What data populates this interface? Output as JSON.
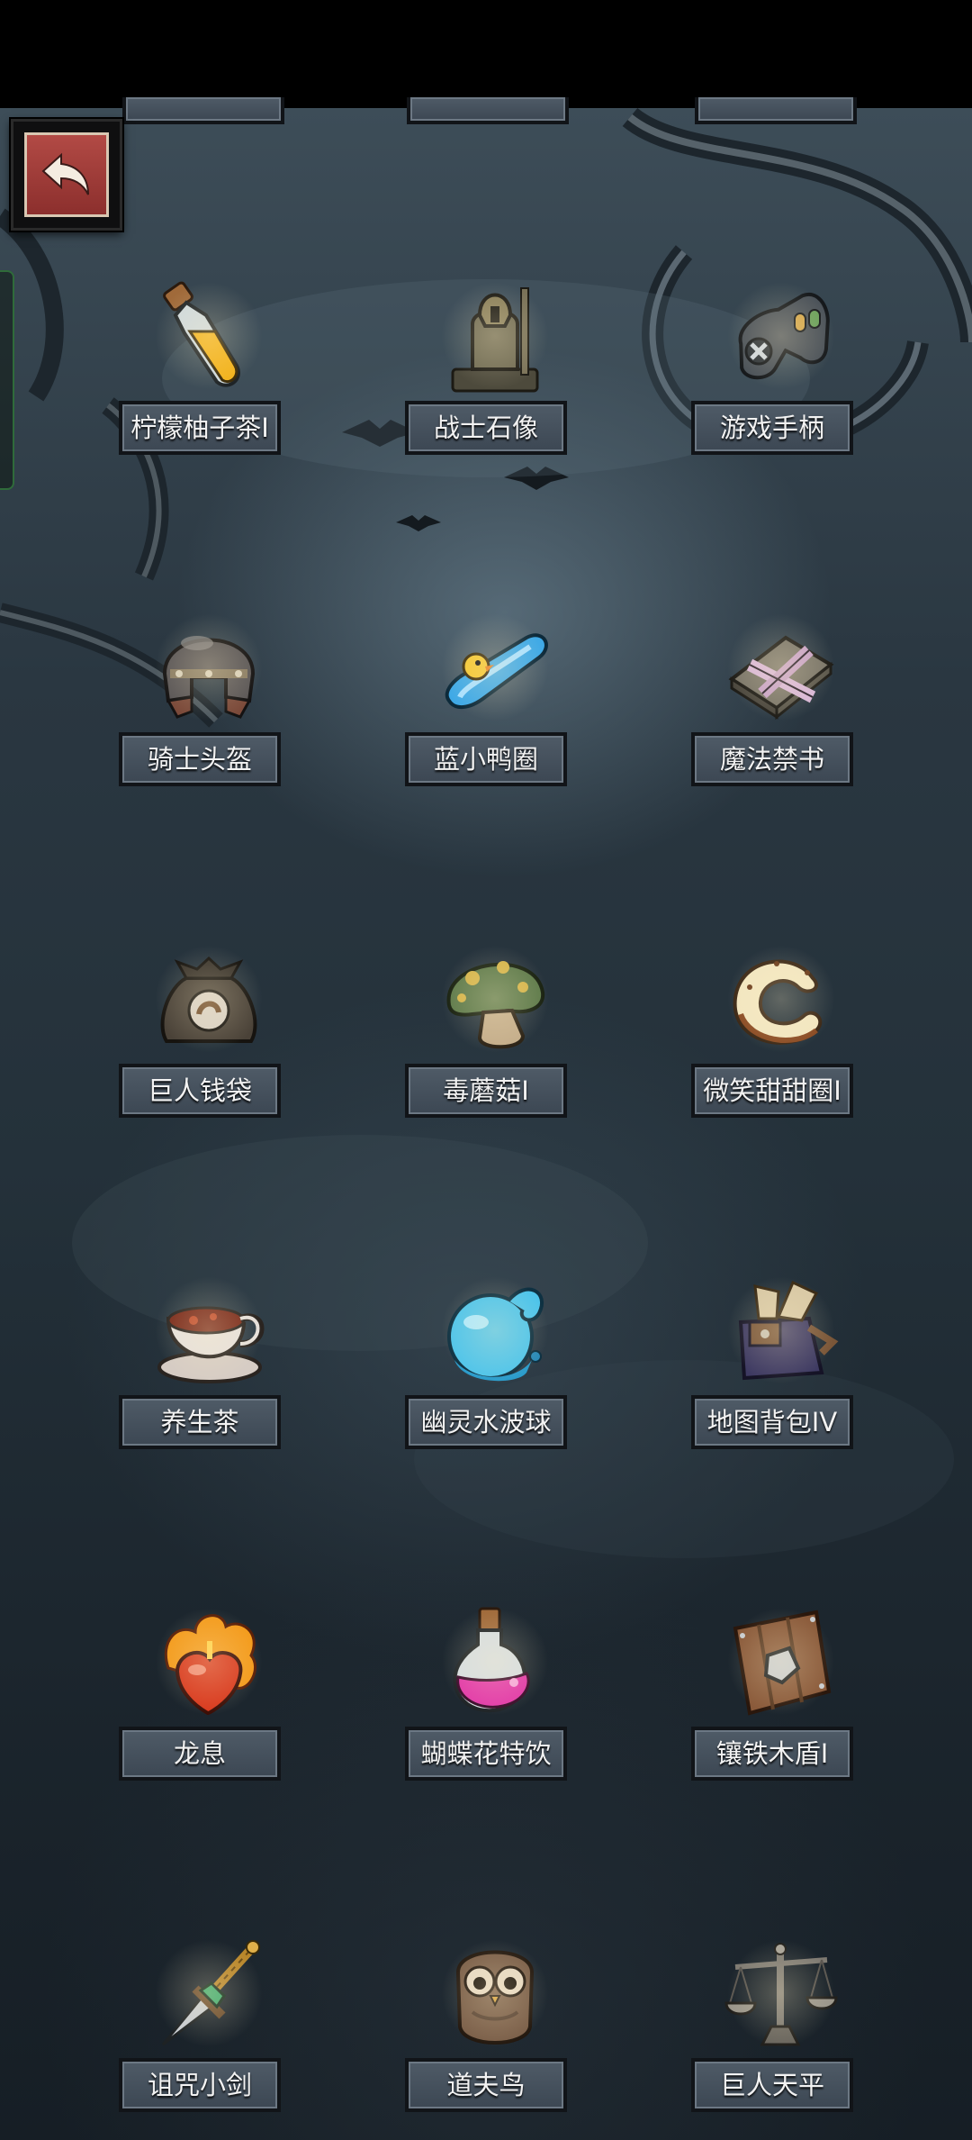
{
  "back_button": {
    "icon": "back-arrow-icon"
  },
  "items": [
    {
      "name": "柠檬柚子茶I",
      "icon": "lemon-potion-icon"
    },
    {
      "name": "战士石像",
      "icon": "warrior-statue-icon"
    },
    {
      "name": "游戏手柄",
      "icon": "gamepad-icon"
    },
    {
      "name": "骑士头盔",
      "icon": "knight-helmet-icon"
    },
    {
      "name": "蓝小鸭圈",
      "icon": "duck-swim-ring-icon"
    },
    {
      "name": "魔法禁书",
      "icon": "forbidden-spellbook-icon"
    },
    {
      "name": "巨人钱袋",
      "icon": "giant-money-bag-icon"
    },
    {
      "name": "毒蘑菇I",
      "icon": "poison-mushroom-icon"
    },
    {
      "name": "微笑甜甜圈I",
      "icon": "smile-donut-icon"
    },
    {
      "name": "养生茶",
      "icon": "tea-cup-icon"
    },
    {
      "name": "幽灵水波球",
      "icon": "water-orb-icon"
    },
    {
      "name": "地图背包IV",
      "icon": "map-backpack-icon"
    },
    {
      "name": "龙息",
      "icon": "dragon-breath-icon"
    },
    {
      "name": "蝴蝶花特饮",
      "icon": "pink-potion-icon"
    },
    {
      "name": "镶铁木盾I",
      "icon": "iron-wood-shield-icon"
    },
    {
      "name": "诅咒小剑",
      "icon": "cursed-dagger-icon"
    },
    {
      "name": "道夫鸟",
      "icon": "owl-icon"
    },
    {
      "name": "巨人天平",
      "icon": "giant-scale-icon"
    }
  ]
}
